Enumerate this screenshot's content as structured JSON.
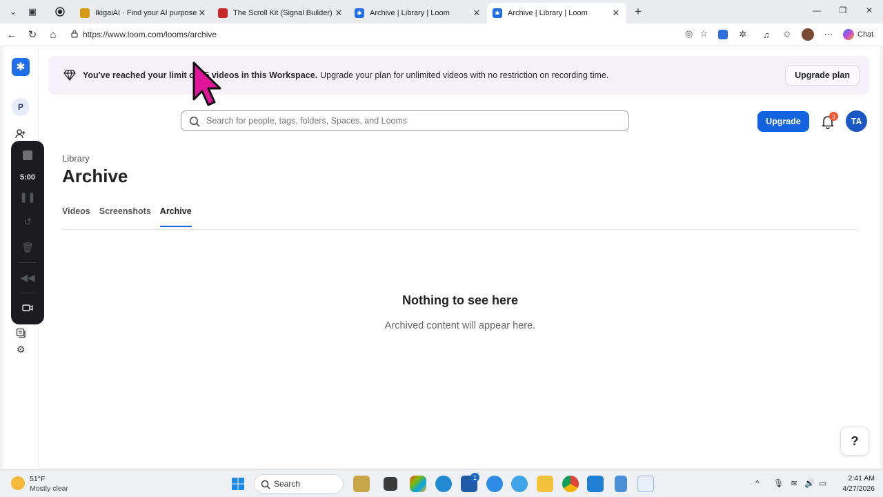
{
  "browser": {
    "tabs": [
      {
        "title": "IkigaiAI · Find your AI purpose",
        "active": false
      },
      {
        "title": "The Scroll Kit (Signal Builder) · Ikig",
        "active": false
      },
      {
        "title": "Archive | Library | Loom",
        "active": false
      },
      {
        "title": "Archive | Library | Loom",
        "active": true
      }
    ],
    "new_tab_icon": "plus-icon",
    "url": "https://www.loom.com/looms/archive",
    "chat_label": "Chat"
  },
  "banner": {
    "bold_text": "You've reached your limit of 25 videos in this Workspace.",
    "text": "Upgrade your plan for unlimited videos with no restriction on recording time.",
    "button_label": "Upgrade plan"
  },
  "header": {
    "search_placeholder": "Search for people, tags, folders, Spaces, and Looms",
    "upgrade_label": "Upgrade",
    "notification_count": "3",
    "user_initials": "TA"
  },
  "sidebar": {
    "workspace_initial": "P"
  },
  "recorder": {
    "timer": "5:00"
  },
  "main": {
    "breadcrumb": "Library",
    "title": "Archive",
    "tabs": [
      {
        "label": "Videos",
        "active": false
      },
      {
        "label": "Screenshots",
        "active": false
      },
      {
        "label": "Archive",
        "active": true
      }
    ],
    "empty_title": "Nothing to see here",
    "empty_subtitle": "Archived content will appear here."
  },
  "help_label": "?",
  "taskbar": {
    "weather_temp": "51°F",
    "weather_condition": "Mostly clear",
    "search_label": "Search",
    "time": "2:41 AM",
    "date": "4/27/2026",
    "store_badge": "1"
  },
  "colors": {
    "accent": "#1363df",
    "banner_bg": "#f6f0fb",
    "cursor": "#e0169a"
  }
}
